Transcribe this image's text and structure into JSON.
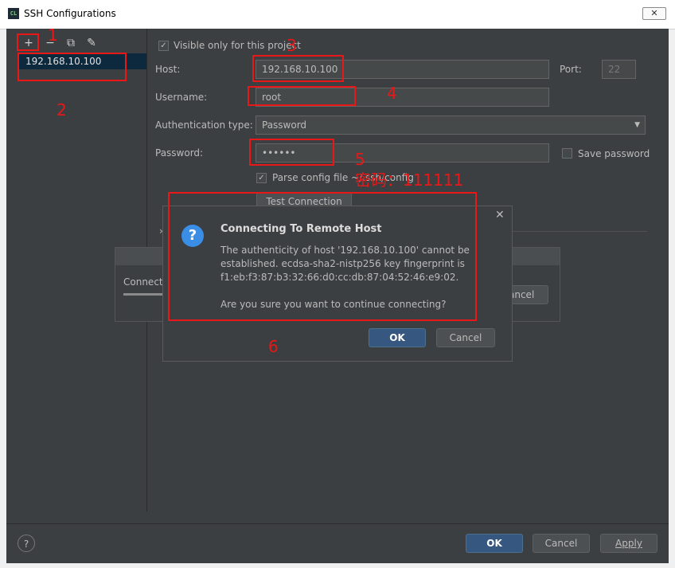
{
  "window": {
    "title": "SSH Configurations",
    "close_glyph": "✕",
    "app_icon_text": "CL"
  },
  "toolbar": {
    "add": "+",
    "remove": "−",
    "copy": "⧉",
    "edit": "✎"
  },
  "hosts": [
    "192.168.10.100"
  ],
  "form": {
    "visible_only_label": "Visible only for this project",
    "host_label": "Host:",
    "host_value": "192.168.10.100",
    "port_label": "Port:",
    "port_value": "22",
    "username_label": "Username:",
    "username_value": "root",
    "auth_label": "Authentication type:",
    "auth_value": "Password",
    "password_label": "Password:",
    "password_value": "••••••",
    "save_password_label": "Save password",
    "parse_config_label": "Parse config file ~/.ssh/config",
    "test_connection_label": "Test Connection"
  },
  "progress_dialog": {
    "text": "Connecti",
    "cancel": "ancel"
  },
  "modal": {
    "title": "Connecting To Remote Host",
    "line1": "The authenticity of host '192.168.10.100' cannot be",
    "line2": "established. ecdsa-sha2-nistp256 key fingerprint is",
    "line3": "f1:eb:f3:87:b3:32:66:d0:cc:db:87:04:52:46:e9:02.",
    "line4": "Are you sure you want to continue connecting?",
    "ok": "OK",
    "cancel": "Cancel",
    "close": "✕",
    "icon": "?"
  },
  "footer": {
    "help": "?",
    "ok": "OK",
    "cancel": "Cancel",
    "apply": "Apply"
  },
  "annotations": {
    "n1": "1",
    "n2": "2",
    "n3": "3",
    "n4": "4",
    "n5": "5",
    "n6": "6",
    "password_note": "密码：111111"
  },
  "colors": {
    "annotation": "#e81818",
    "accent": "#365880",
    "background": "#3c3f41"
  }
}
